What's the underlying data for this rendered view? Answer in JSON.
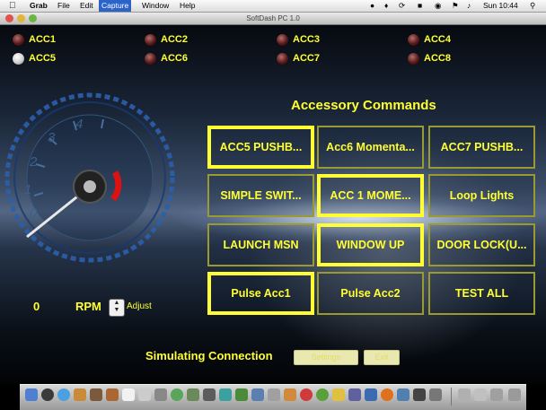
{
  "menubar": {
    "app": "Grab",
    "items": [
      "File",
      "Edit",
      "Capture",
      "Window",
      "Help"
    ],
    "selected": "Capture",
    "clock": "Sun 10:44"
  },
  "window": {
    "title": "SoftDash PC 1.0"
  },
  "accessories": [
    {
      "label": "ACC1",
      "on": false
    },
    {
      "label": "ACC2",
      "on": false
    },
    {
      "label": "ACC3",
      "on": false
    },
    {
      "label": "ACC4",
      "on": false
    },
    {
      "label": "ACC5",
      "on": true
    },
    {
      "label": "ACC6",
      "on": false
    },
    {
      "label": "ACC7",
      "on": false
    },
    {
      "label": "ACC8",
      "on": false
    }
  ],
  "commands": {
    "title": "Accessory Commands",
    "buttons": [
      {
        "label": "ACC5 PUSHB...",
        "selected": true
      },
      {
        "label": "Acc6 Momenta...",
        "selected": false
      },
      {
        "label": "ACC7 PUSHB...",
        "selected": false
      },
      {
        "label": "SIMPLE SWIT...",
        "selected": false
      },
      {
        "label": "ACC 1 MOME...",
        "selected": true
      },
      {
        "label": "Loop Lights",
        "selected": false
      },
      {
        "label": "LAUNCH MSN",
        "selected": false
      },
      {
        "label": "WINDOW UP",
        "selected": true
      },
      {
        "label": "DOOR LOCK(U...",
        "selected": false
      },
      {
        "label": "Pulse Acc1",
        "selected": true
      },
      {
        "label": "Pulse Acc2",
        "selected": false
      },
      {
        "label": "TEST ALL",
        "selected": false
      }
    ]
  },
  "gauge": {
    "ticks": [
      "0",
      "1",
      "2",
      "3",
      "4"
    ]
  },
  "rpm": {
    "value": "0",
    "label": "RPM",
    "adjust": "Adjust"
  },
  "status": {
    "text": "Simulating Connection",
    "settings": "Settings",
    "exit": "Exit"
  },
  "colors": {
    "accent": "#ffff33",
    "led_off": "#5a1a1a",
    "led_on": "#dddddd"
  }
}
